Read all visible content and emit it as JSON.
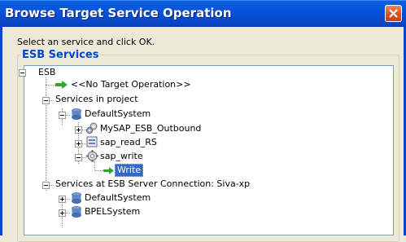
{
  "window": {
    "title": "Browse Target Service Operation"
  },
  "instruction": "Select an service and click OK.",
  "group": {
    "label": "ESB Services"
  },
  "tree": {
    "root": "ESB",
    "no_target": "<<No Target Operation>>",
    "services_in_project": "Services in project",
    "default_system": "DefaultSystem",
    "mysap_outbound": "MySAP_ESB_Outbound",
    "sap_read": "sap_read_RS",
    "sap_write": "sap_write",
    "write_op": "Write",
    "server_services": "Services at ESB Server Connection: Siva-xp",
    "server_default_system": "DefaultSystem",
    "bpel_system": "BPELSystem"
  }
}
